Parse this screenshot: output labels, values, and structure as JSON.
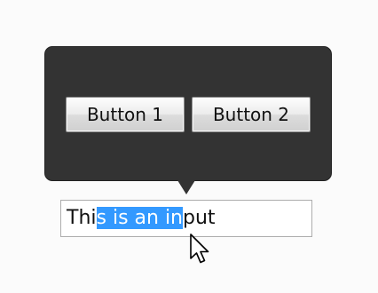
{
  "popup": {
    "buttons": [
      {
        "label": "Button 1"
      },
      {
        "label": "Button 2"
      }
    ]
  },
  "input": {
    "before_selection": "Thi",
    "selected": "s is an in",
    "after_selection": "put"
  },
  "cursor": {
    "icon": "mouse-pointer-icon"
  },
  "colors": {
    "popup_bg": "#333333",
    "selection": "#3399ff"
  }
}
